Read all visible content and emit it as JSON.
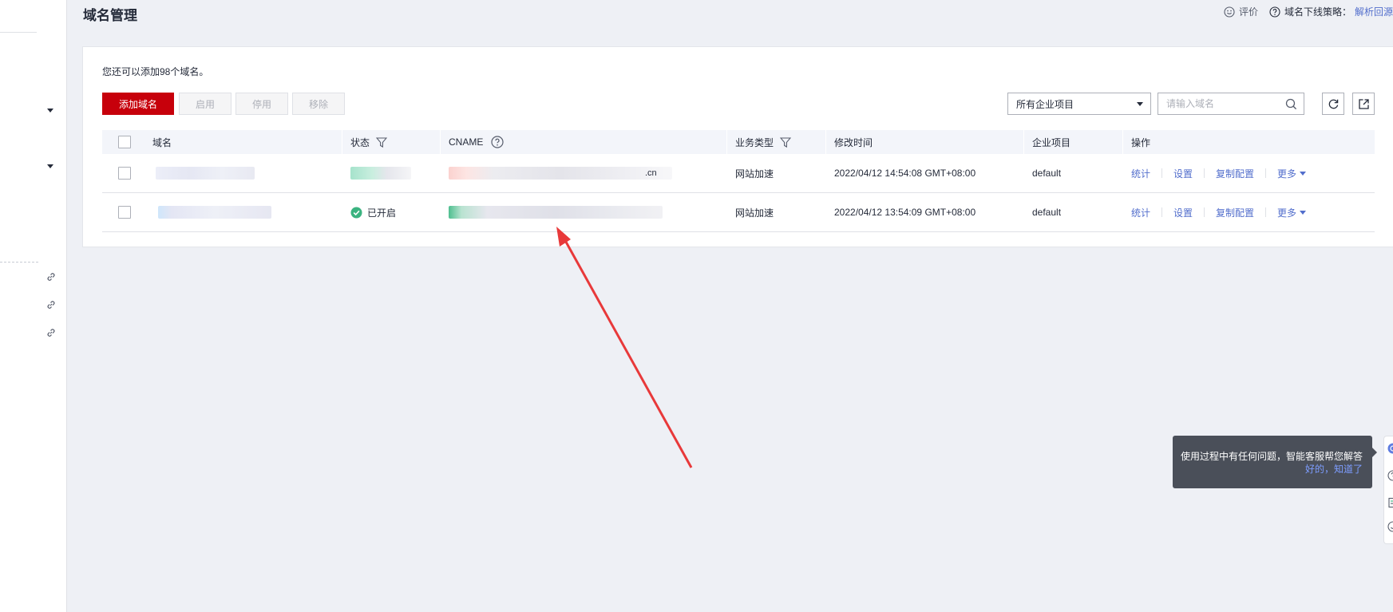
{
  "header": {
    "title": "域名管理",
    "evaluate_label": "评价",
    "policy_label": "域名下线策略：",
    "policy_link": "解析回源"
  },
  "toolbar": {
    "quota_text": "您还可以添加98个域名。",
    "add_label": "添加域名",
    "enable_label": "启用",
    "disable_label": "停用",
    "remove_label": "移除",
    "project_select": "所有企业项目",
    "search_placeholder": "请输入域名"
  },
  "table": {
    "columns": {
      "domain": "域名",
      "status": "状态",
      "cname": "CNAME",
      "service_type": "业务类型",
      "modified": "修改时间",
      "project": "企业项目",
      "ops": "操作"
    },
    "rows": [
      {
        "status": "",
        "cname_suffix": ".cn",
        "service_type": "网站加速",
        "modified": "2022/04/12 14:54:08 GMT+08:00",
        "project": "default"
      },
      {
        "status": "已开启",
        "cname_suffix": "",
        "service_type": "网站加速",
        "modified": "2022/04/12 13:54:09 GMT+08:00",
        "project": "default"
      }
    ],
    "ops": {
      "stats": "统计",
      "settings": "设置",
      "copy": "复制配置",
      "more": "更多"
    }
  },
  "assistant": {
    "tooltip_text": "使用过程中有任何问题，智能客服帮您解答",
    "tooltip_ok": "好的，知道了"
  },
  "colors": {
    "brand_red": "#c7000b",
    "link_blue": "#526ecc",
    "status_green": "#3bb380",
    "annotation_arrow": "#e8393a"
  }
}
